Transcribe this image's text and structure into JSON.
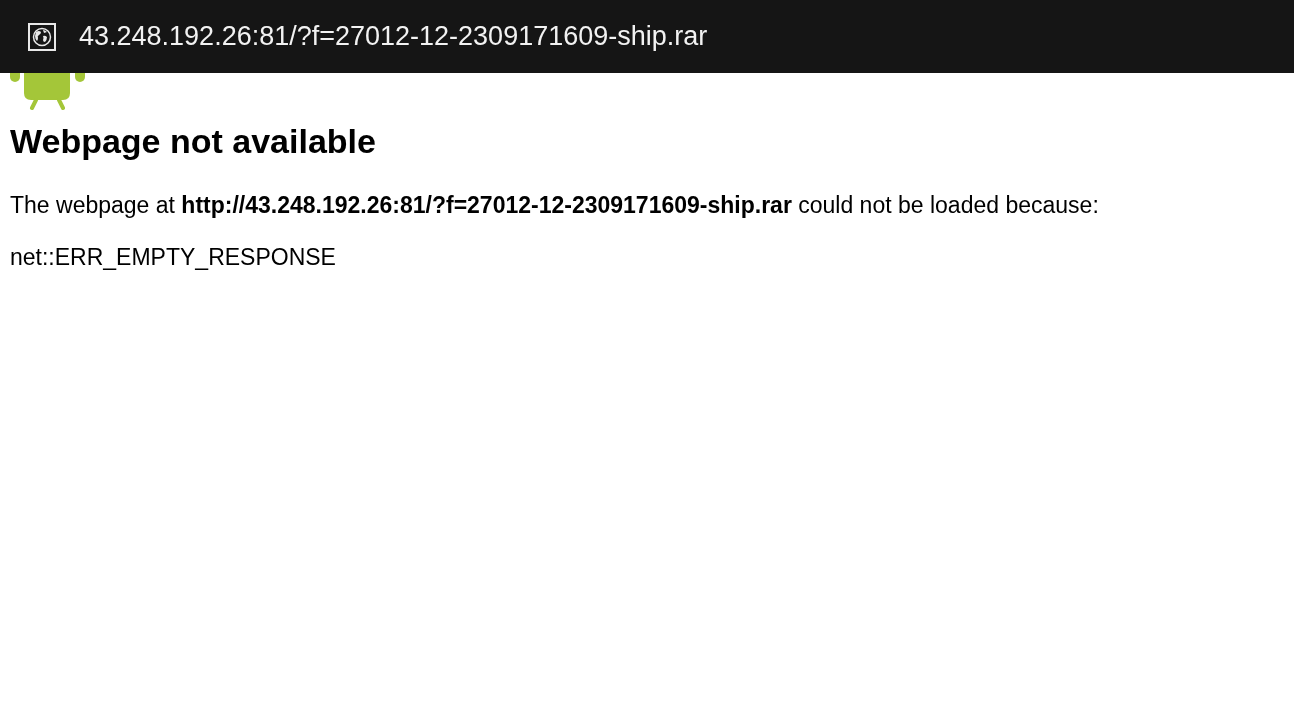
{
  "title_bar": {
    "url": "43.248.192.26:81/?f=27012-12-2309171609-ship.rar"
  },
  "error": {
    "heading": "Webpage not available",
    "message": "The webpage at **http://43.248.192.26:81/?f=27012-12-2309171609-ship.rar** could not be loaded because:",
    "code": "net::ERR_EMPTY_RESPONSE"
  }
}
